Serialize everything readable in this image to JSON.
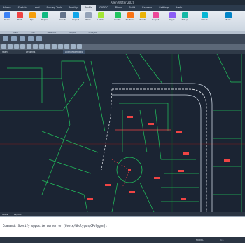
{
  "app": {
    "title": "Allen Water 2020"
  },
  "ribbon_tabs": [
    {
      "label": "Home"
    },
    {
      "label": "Sketch"
    },
    {
      "label": "Land"
    },
    {
      "label": "Survey Tools"
    },
    {
      "label": "Modify"
    },
    {
      "label": "Profile"
    },
    {
      "label": "GIS/GC"
    },
    {
      "label": "Pipes"
    },
    {
      "label": "Build"
    },
    {
      "label": "Express"
    },
    {
      "label": "Settings"
    },
    {
      "label": "Help"
    }
  ],
  "ribbon_buttons": [
    {
      "label": "Draw"
    },
    {
      "label": "Edit"
    },
    {
      "label": "Pipe"
    },
    {
      "label": "Report"
    },
    {
      "label": "Create"
    },
    {
      "label": "Import"
    },
    {
      "label": "Table"
    },
    {
      "label": "Labels"
    },
    {
      "label": "Profile"
    },
    {
      "label": "Sections"
    },
    {
      "label": "Points"
    },
    {
      "label": "Output"
    },
    {
      "label": "Style"
    },
    {
      "label": "Setup"
    },
    {
      "label": "Check"
    },
    {
      "label": "Tools"
    }
  ],
  "panel_titles": [
    "Draw",
    "Edit",
    "Network",
    "Output",
    "Analysis"
  ],
  "doc_tabs": [
    {
      "label": "Start"
    },
    {
      "label": "Drawing1"
    },
    {
      "label": "Allen Water.dwg"
    }
  ],
  "layout_tabs": [
    "Model",
    "Layout1"
  ],
  "command_line": {
    "text": "Command: Specify opposite corner or [Fence/WPolygon/CPolygon]:"
  },
  "status": {
    "coords": "MODEL",
    "scale": "1:1"
  },
  "colors": {
    "canvas": "#1b2433",
    "lot_lines": "#22c55e",
    "road": "#d1d5db",
    "labels": "#ef4444"
  },
  "icons": [
    "save-icon",
    "undo-icon",
    "redo-icon",
    "open-icon",
    "print-icon"
  ]
}
